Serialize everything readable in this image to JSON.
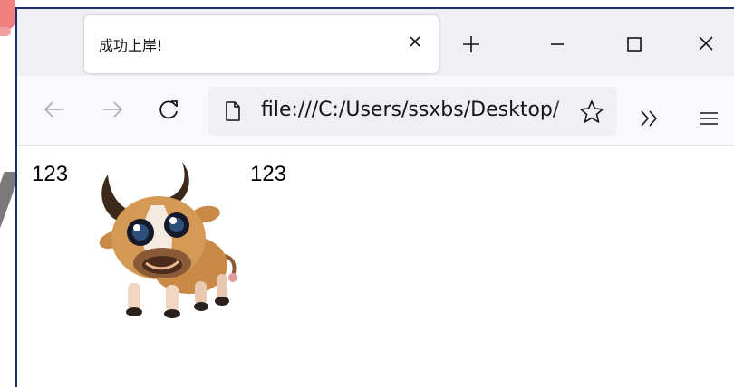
{
  "browser": {
    "tab_title": "成功上岸!",
    "url": "file:///C:/Users/ssxbs/Desktop/"
  },
  "icons": {
    "tab_close": "close-icon",
    "new_tab": "plus-icon",
    "minimize": "minimize-icon",
    "maximize": "maximize-icon",
    "close_window": "close-icon",
    "back": "arrow-left-icon",
    "forward": "arrow-right-icon",
    "reload": "reload-icon",
    "page": "page-icon",
    "bookmark": "star-icon",
    "overflow": "chevrons-right-icon",
    "menu": "hamburger-icon"
  },
  "page": {
    "text_left": "123",
    "text_right": "123",
    "image": "bull-image"
  },
  "colors": {
    "tabstrip_bg": "#f0f0f4",
    "navbar_bg": "#f9f9fb",
    "window_border": "#1d2d6e"
  }
}
